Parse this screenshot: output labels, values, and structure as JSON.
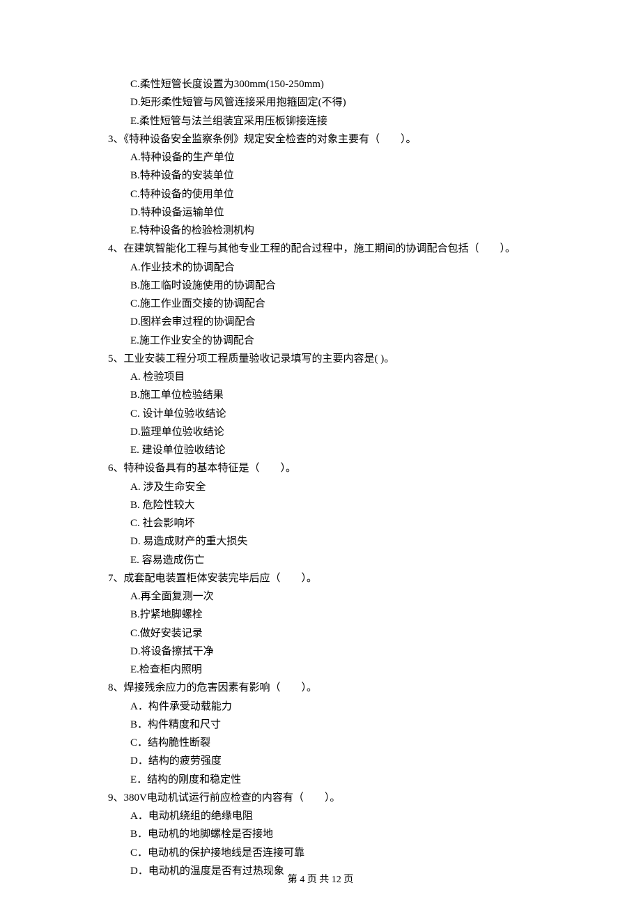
{
  "prev_options": {
    "c": "C.柔性短管长度设置为300mm(150-250mm)",
    "d": "D.矩形柔性短管与风管连接采用抱箍固定(不得)",
    "e": "E.柔性短管与法兰组装宜采用压板铆接连接"
  },
  "q3": {
    "stem": "3、《特种设备安全监察条例》规定安全检查的对象主要有（　　）。",
    "a": "A.特种设备的生产单位",
    "b": "B.特种设备的安装单位",
    "c": "C.特种设备的使用单位",
    "d": "D.特种设备运输单位",
    "e": "E.特种设备的检验检测机构"
  },
  "q4": {
    "stem": "4、在建筑智能化工程与其他专业工程的配合过程中，施工期间的协调配合包括（　　）。",
    "a": "A.作业技术的协调配合",
    "b": "B.施工临时设施使用的协调配合",
    "c": "C.施工作业面交接的协调配合",
    "d": "D.图样会审过程的协调配合",
    "e": "E.施工作业安全的协调配合"
  },
  "q5": {
    "stem": "5、工业安装工程分项工程质量验收记录填写的主要内容是(  )。",
    "a": "A. 检验项目",
    "b": "B.施工单位检验结果",
    "c": "C. 设计单位验收结论",
    "d": "D.监理单位验收结论",
    "e": "E. 建设单位验收结论"
  },
  "q6": {
    "stem": "6、特种设备具有的基本特征是（　　）。",
    "a": "A.  涉及生命安全",
    "b": "B.  危险性较大",
    "c": "C.  社会影响坏",
    "d": "D.  易造成财产的重大损失",
    "e": "E.  容易造成伤亡"
  },
  "q7": {
    "stem": "7、成套配电装置柜体安装完毕后应（　　）。",
    "a": "A.再全面复测一次",
    "b": "B.拧紧地脚螺栓",
    "c": "C.做好安装记录",
    "d": "D.将设备擦拭干净",
    "e": "E.检查柜内照明"
  },
  "q8": {
    "stem": "8、焊接残余应力的危害因素有影响（　　）。",
    "a": "A．构件承受动载能力",
    "b": "B．构件精度和尺寸",
    "c": "C．结构脆性断裂",
    "d": "D．结构的疲劳强度",
    "e": "E．结构的刚度和稳定性"
  },
  "q9": {
    "stem": "9、380V电动机试运行前应检查的内容有（　　）。",
    "a": "A．电动机绕组的绝缘电阻",
    "b": "B．电动机的地脚螺栓是否接地",
    "c": "C．电动机的保护接地线是否连接可靠",
    "d": "D．电动机的温度是否有过热现象"
  },
  "footer": "第 4 页 共 12 页"
}
